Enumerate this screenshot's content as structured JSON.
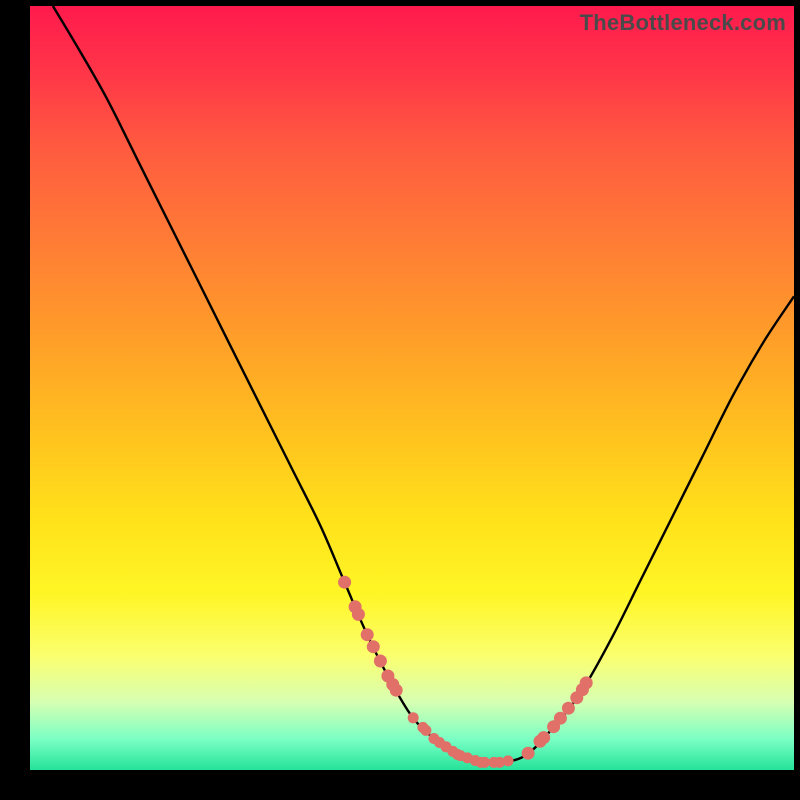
{
  "watermark": "TheBottleneck.com",
  "chart_data": {
    "type": "line",
    "title": "",
    "xlabel": "",
    "ylabel": "",
    "xlim": [
      0,
      100
    ],
    "ylim": [
      0,
      100
    ],
    "grid": false,
    "legend": false,
    "series": [
      {
        "name": "curve",
        "x": [
          3,
          6,
          10,
          14,
          18,
          22,
          26,
          30,
          34,
          38,
          41,
          44,
          47,
          50,
          53,
          56,
          59,
          62,
          65,
          68,
          72,
          76,
          80,
          84,
          88,
          92,
          96,
          100
        ],
        "y": [
          100,
          95,
          88,
          80,
          72,
          64,
          56,
          48,
          40,
          32,
          25,
          18,
          12,
          7,
          4,
          2,
          1,
          1,
          2,
          5,
          10,
          17,
          25,
          33,
          41,
          49,
          56,
          62
        ]
      }
    ],
    "annotations": {
      "red_dot_clusters": [
        {
          "name": "left-slope",
          "x_range": [
            41,
            49
          ],
          "y_range": [
            24,
            8
          ]
        },
        {
          "name": "valley",
          "x_range": [
            50,
            63
          ],
          "y_range": [
            1,
            3
          ]
        },
        {
          "name": "right-slope",
          "x_range": [
            65,
            74
          ],
          "y_range": [
            4,
            14
          ]
        }
      ]
    }
  }
}
